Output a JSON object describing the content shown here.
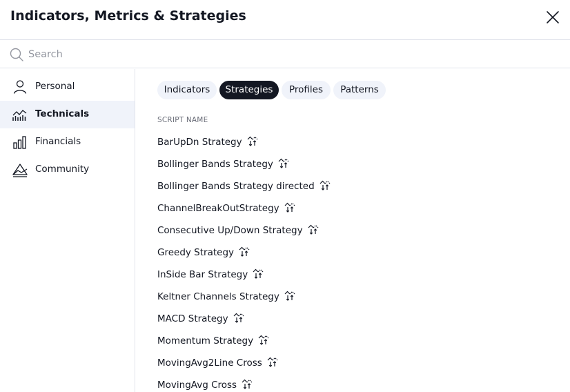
{
  "dialog": {
    "title": "Indicators, Metrics & Strategies"
  },
  "search": {
    "placeholder": "Search",
    "value": ""
  },
  "sidebar": {
    "items": [
      {
        "label": "Personal",
        "icon": "person-icon",
        "active": false
      },
      {
        "label": "Technicals",
        "icon": "technicals-icon",
        "active": true
      },
      {
        "label": "Financials",
        "icon": "financials-icon",
        "active": false
      },
      {
        "label": "Community",
        "icon": "community-icon",
        "active": false
      }
    ]
  },
  "tabs": [
    {
      "label": "Indicators",
      "active": false
    },
    {
      "label": "Strategies",
      "active": true
    },
    {
      "label": "Profiles",
      "active": false
    },
    {
      "label": "Patterns",
      "active": false
    }
  ],
  "list": {
    "column_header": "SCRIPT NAME",
    "scripts": [
      "BarUpDn Strategy",
      "Bollinger Bands Strategy",
      "Bollinger Bands Strategy directed",
      "ChannelBreakOutStrategy",
      "Consecutive Up/Down Strategy",
      "Greedy Strategy",
      "InSide Bar Strategy",
      "Keltner Channels Strategy",
      "MACD Strategy",
      "Momentum Strategy",
      "MovingAvg2Line Cross",
      "MovingAvg Cross"
    ]
  },
  "colors": {
    "active_tab_bg": "#131722",
    "tab_bg": "#f0f3fa",
    "sidebar_active_bg": "#f0f3fa",
    "border": "#e0e3eb",
    "text": "#131722",
    "muted_text": "#9598a1"
  }
}
